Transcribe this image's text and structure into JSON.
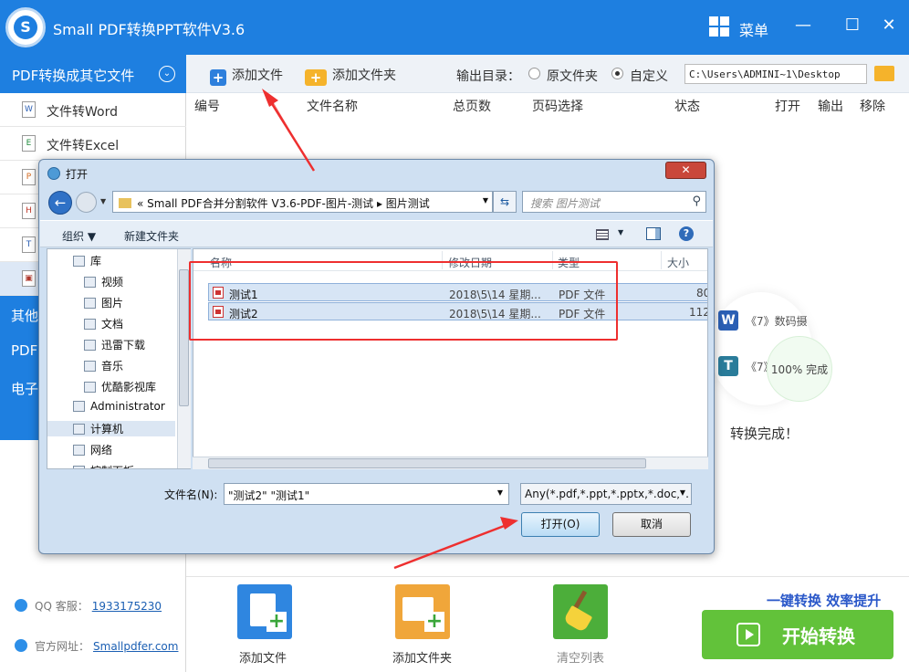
{
  "app": {
    "title": "Small PDF转换PPT软件V3.6",
    "logo_letter": "S",
    "menu_label": "菜单",
    "win_controls": [
      "—",
      "☐",
      "✕"
    ]
  },
  "sidebar": {
    "header": "PDF转换成其它文件",
    "items": [
      {
        "icon": "word-doc-icon",
        "glyph": "W",
        "label": "文件转Word"
      },
      {
        "icon": "excel-doc-icon",
        "glyph": "E",
        "label": "文件转Excel"
      },
      {
        "icon": "ppt-doc-icon",
        "glyph": "P",
        "label": ""
      },
      {
        "icon": "html-doc-icon",
        "glyph": "H",
        "label": ""
      },
      {
        "icon": "txt-doc-icon",
        "glyph": "T",
        "label": ""
      },
      {
        "icon": "image-doc-icon",
        "glyph": "▣",
        "label": ""
      }
    ],
    "sections": [
      "其他",
      "PDF",
      "电子"
    ],
    "qq_label": "QQ 客服：",
    "qq_value": "1933175230",
    "site_label": "官方网址：",
    "site_value": "Smallpdfer.com"
  },
  "toolbar": {
    "add_file": "添加文件",
    "add_folder": "添加文件夹",
    "output_dir_label": "输出目录：",
    "radio_original": "原文件夹",
    "radio_custom": "自定义",
    "radio_selected": "custom",
    "output_path": "C:\\Users\\ADMINI~1\\Desktop"
  },
  "columns": [
    "编号",
    "文件名称",
    "总页数",
    "页码选择",
    "状态",
    "打开",
    "输出",
    "移除"
  ],
  "background_hint": {
    "item1": "《7》数码摄",
    "item2": "《7》",
    "progress": "100%",
    "progress_status": "完成",
    "done_text": "转换完成！"
  },
  "bottom": {
    "add_file": "添加文件",
    "add_folder": "添加文件夹",
    "clear_list": "清空列表",
    "slogan": "一键转换  效率提升",
    "start": "开始转换"
  },
  "dialog": {
    "title": "打开",
    "close": "✕",
    "address": "«  Small PDF合并分割软件 V3.6-PDF-图片-测试  ▸  图片测试",
    "search_placeholder": "搜索 图片测试",
    "cmd_organize": "组织 ▼",
    "cmd_new_folder": "新建文件夹",
    "tree": [
      {
        "icon": "library-icon",
        "label": "库",
        "indent": 1
      },
      {
        "icon": "video-icon",
        "label": "视频",
        "indent": 2
      },
      {
        "icon": "picture-icon",
        "label": "图片",
        "indent": 2
      },
      {
        "icon": "document-icon",
        "label": "文档",
        "indent": 2
      },
      {
        "icon": "thunder-download-icon",
        "label": "迅雷下载",
        "indent": 2
      },
      {
        "icon": "music-icon",
        "label": "音乐",
        "indent": 2
      },
      {
        "icon": "youku-icon",
        "label": "优酷影视库",
        "indent": 2
      },
      {
        "icon": "user-icon",
        "label": "Administrator",
        "indent": 1
      },
      {
        "icon": "computer-icon",
        "label": "计算机",
        "indent": 1
      },
      {
        "icon": "network-icon",
        "label": "网络",
        "indent": 1
      },
      {
        "icon": "control-panel-icon",
        "label": "控制面板",
        "indent": 1
      }
    ],
    "list_headers": [
      "名称",
      "修改日期",
      "类型",
      "大小"
    ],
    "files": [
      {
        "name": "测试1",
        "date": "2018\\5\\14 星期...",
        "type": "PDF 文件",
        "size": "80"
      },
      {
        "name": "测试2",
        "date": "2018\\5\\14 星期...",
        "type": "PDF 文件",
        "size": "112"
      }
    ],
    "filename_label": "文件名(N):",
    "filename_value": "\"测试2\" \"测试1\"",
    "filter_value": "Any(*.pdf,*.ppt,*.pptx,*.doc,*.",
    "open_button": "打开(O)",
    "cancel_button": "取消"
  }
}
